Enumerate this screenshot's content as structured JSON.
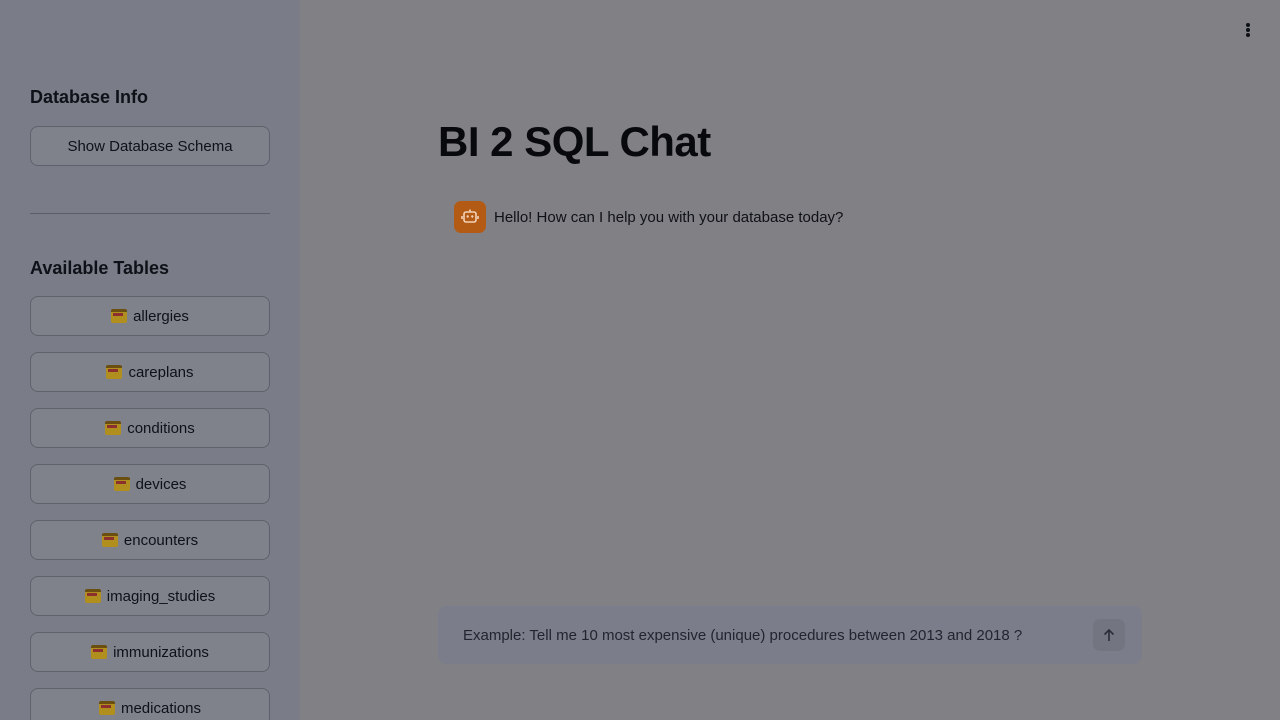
{
  "sidebar": {
    "db_info_heading": "Database Info",
    "show_schema_label": "Show Database Schema",
    "tables_heading": "Available Tables",
    "tables": [
      {
        "label": "allergies"
      },
      {
        "label": "careplans"
      },
      {
        "label": "conditions"
      },
      {
        "label": "devices"
      },
      {
        "label": "encounters"
      },
      {
        "label": "imaging_studies"
      },
      {
        "label": "immunizations"
      },
      {
        "label": "medications"
      }
    ]
  },
  "main": {
    "title": "BI 2 SQL Chat",
    "messages": [
      {
        "role": "assistant",
        "text": "Hello! How can I help you with your database today?"
      }
    ]
  },
  "chat_input": {
    "placeholder": "Example: Tell me 10 most expensive (unique) procedures between 2013 and 2018 ?",
    "value": ""
  },
  "icons": {
    "table": "card-index-dividers-icon",
    "assistant": "robot-icon",
    "send": "arrow-up-icon",
    "menu": "more-vertical-icon"
  },
  "colors": {
    "assistant_avatar": "#b35a14",
    "sidebar_bg": "#7a7d87",
    "main_bg": "#808085"
  }
}
